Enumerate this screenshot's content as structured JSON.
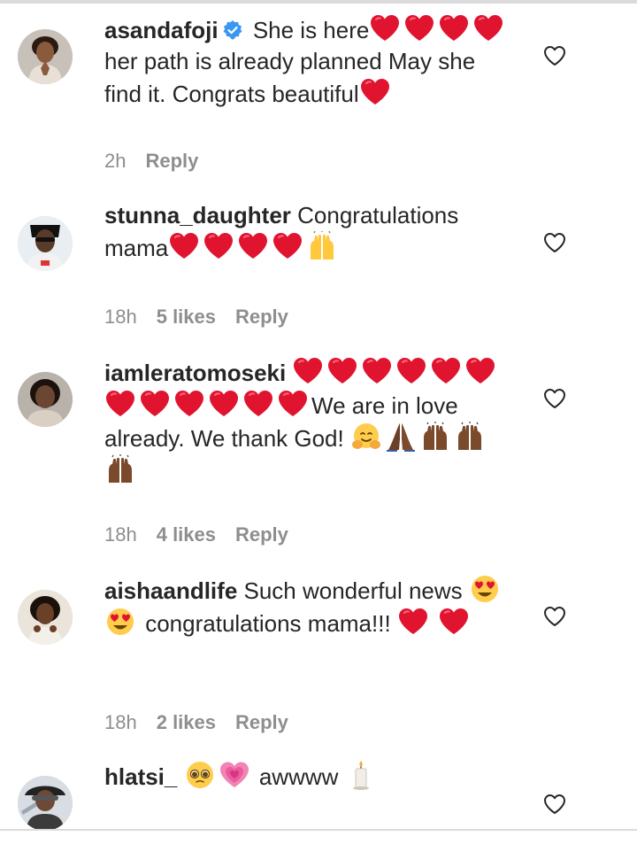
{
  "comments": [
    {
      "username": "asandafoji",
      "verified": true,
      "time": "2h",
      "likes": "",
      "reply": "Reply",
      "t1": " She is here",
      "t2": " her path is already planned May she find it. Congrats beautiful",
      "avatar_colors": {
        "bg": "#c7c1ba",
        "skin": "#8a5a3c",
        "hair": "#2a1a12",
        "top": "#e8e0d6"
      }
    },
    {
      "username": "stunna_daughter",
      "verified": false,
      "time": "18h",
      "likes": "5 likes",
      "reply": "Reply",
      "t1": " Congratulations mama",
      "avatar_colors": {
        "bg": "#e9eef2",
        "skin": "#5a3a28",
        "hair": "#111111",
        "top": "#f2f2f2"
      }
    },
    {
      "username": "iamleratomoseki",
      "verified": false,
      "time": "18h",
      "likes": "4 likes",
      "reply": "Reply",
      "t1": "We are in love already. We thank God! ",
      "avatar_colors": {
        "bg": "#b9b2ab",
        "skin": "#6b4632",
        "hair": "#1c120d",
        "top": "#d9cfc3"
      }
    },
    {
      "username": "aishaandlife",
      "verified": false,
      "time": "18h",
      "likes": "2 likes",
      "reply": "Reply",
      "t1": " Such wonderful news",
      "t2": " congratulations mama!!! ",
      "avatar_colors": {
        "bg": "#eae4da",
        "skin": "#6a4028",
        "hair": "#1a110b",
        "top": "#f3efe9"
      }
    },
    {
      "username": "hlatsi_",
      "verified": false,
      "time": "",
      "likes": "",
      "reply": "",
      "t1": " awwww ",
      "avatar_colors": {
        "bg": "#d7dde2",
        "skin": "#6e4a34",
        "hair": "#222222",
        "top": "#3b3b3b"
      }
    }
  ],
  "colors": {
    "text": "#262626",
    "meta": "#8e8e8e",
    "heart_red": "#e0142f",
    "verified_blue": "#3897f0",
    "divider": "#dbdbdb"
  },
  "icons": {
    "like": "heart-outline-icon",
    "verified": "verified-badge-icon",
    "emoji_heart": "red-heart-emoji",
    "emoji_raised_hands": "raised-hands-emoji",
    "emoji_hug": "hugging-face-emoji",
    "emoji_pray": "folded-hands-emoji",
    "emoji_heart_eyes": "heart-eyes-emoji",
    "emoji_pleading": "pleading-face-emoji",
    "emoji_pink_heart": "growing-heart-emoji",
    "emoji_candle": "candle-emoji"
  }
}
